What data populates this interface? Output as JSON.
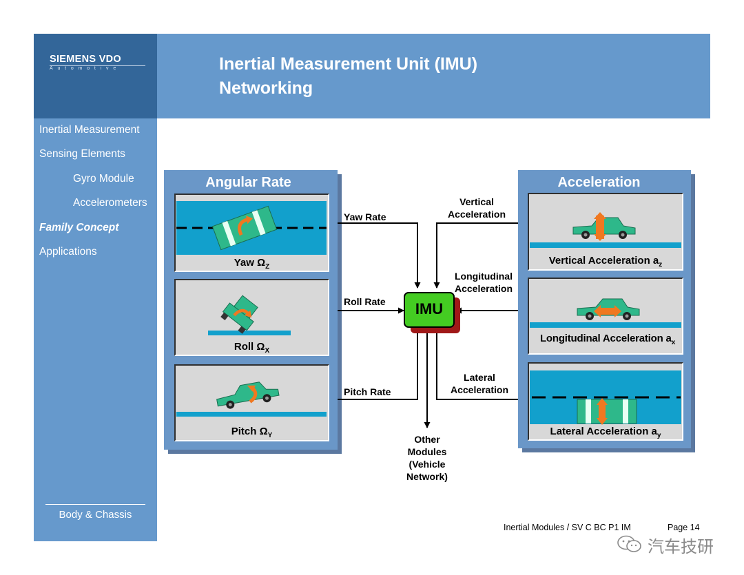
{
  "logo": {
    "brand": "SIEMENS VDO",
    "sub": "Automotive"
  },
  "title": {
    "line1": "Inertial Measurement Unit (IMU)",
    "line2": "Networking"
  },
  "sidebar": {
    "items": [
      {
        "label": "Inertial Measurement"
      },
      {
        "label": "Sensing Elements"
      },
      {
        "label": "Gyro Module"
      },
      {
        "label": "Accelerometers"
      },
      {
        "label": "Family Concept"
      },
      {
        "label": "Applications"
      }
    ],
    "active": "Family Concept",
    "bottom": "Body & Chassis"
  },
  "left_panel": {
    "title": "Angular Rate",
    "boxes": [
      {
        "label": "Yaw",
        "symbol": "Ω",
        "sub": "Z"
      },
      {
        "label": "Roll",
        "symbol": "Ω",
        "sub": "X"
      },
      {
        "label": "Pitch",
        "symbol": "Ω",
        "sub": "Y"
      }
    ]
  },
  "right_panel": {
    "title": "Acceleration",
    "boxes": [
      {
        "label": "Vertical Acceleration a",
        "sub": "z"
      },
      {
        "label": "Longitudinal Acceleration a",
        "sub": "x"
      },
      {
        "label": "Lateral Acceleration a",
        "sub": "y"
      }
    ]
  },
  "connections": {
    "yaw": "Yaw Rate",
    "roll": "Roll Rate",
    "pitch": "Pitch Rate",
    "vertical": [
      "Vertical",
      "Acceleration"
    ],
    "longitudinal": [
      "Longitudinal",
      "Acceleration"
    ],
    "lateral": [
      "Lateral",
      "Acceleration"
    ],
    "other": [
      "Other",
      "Modules",
      "(Vehicle",
      "Network)"
    ]
  },
  "imu": {
    "label": "IMU"
  },
  "footer": {
    "source": "Inertial Modules / SV C BC P1 IM",
    "page": "Page 14"
  },
  "watermark": "汽车技研",
  "colors": {
    "header": "#6699cc",
    "logo_box": "#336699",
    "panel": "#6a97c8",
    "car": "#2eb88a",
    "arrow": "#f07820",
    "road": "#12a0cc",
    "imu_green": "#44cc22",
    "imu_shadow": "#a01818"
  }
}
